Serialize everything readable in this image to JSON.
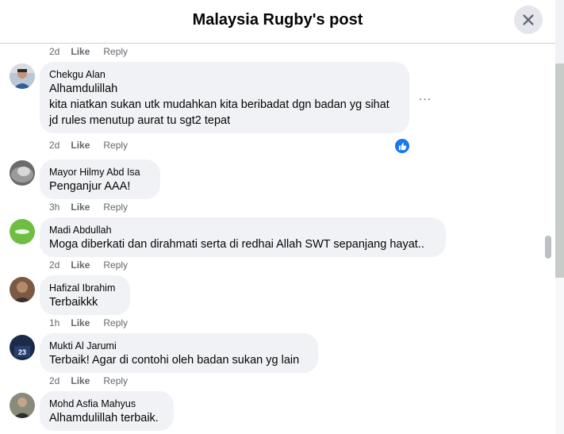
{
  "header": {
    "title": "Malaysia Rugby's post"
  },
  "top_meta": {
    "time": "2d",
    "like": "Like",
    "reply": "Reply"
  },
  "comments": [
    {
      "name": "Chekgu Alan",
      "lines": [
        "Alhamdulillah",
        "kita niatkan sukan utk mudahkan kita beribadat dgn badan yg sihat",
        "jd rules menutup aurat tu sgt2 tepat"
      ],
      "time": "2d",
      "like": "Like",
      "reply": "Reply",
      "more": "...",
      "reaction": "like-icon"
    },
    {
      "name": "Mayor Hilmy Abd Isa",
      "lines": [
        "Penganjur AAA!"
      ],
      "time": "3h",
      "like": "Like",
      "reply": "Reply"
    },
    {
      "name": "Madi Abdullah",
      "lines": [
        "Moga diberkati dan dirahmati serta di redhai Allah SWT sepanjang hayat.."
      ],
      "time": "2d",
      "like": "Like",
      "reply": "Reply"
    },
    {
      "name": "Hafizal Ibrahim",
      "lines": [
        "Terbaikkk"
      ],
      "time": "1h",
      "like": "Like",
      "reply": "Reply"
    },
    {
      "name": "Mukti Al Jarumi",
      "lines": [
        "Terbaik! Agar di contohi oleh badan sukan yg lain"
      ],
      "time": "2d",
      "like": "Like",
      "reply": "Reply"
    },
    {
      "name": "Mohd Asfia Mahyus",
      "lines": [
        "Alhamdulillah terbaik."
      ]
    }
  ],
  "colors": {
    "bubble": "#f0f2f5",
    "meta": "#65676b",
    "accent": "#1877f2"
  }
}
